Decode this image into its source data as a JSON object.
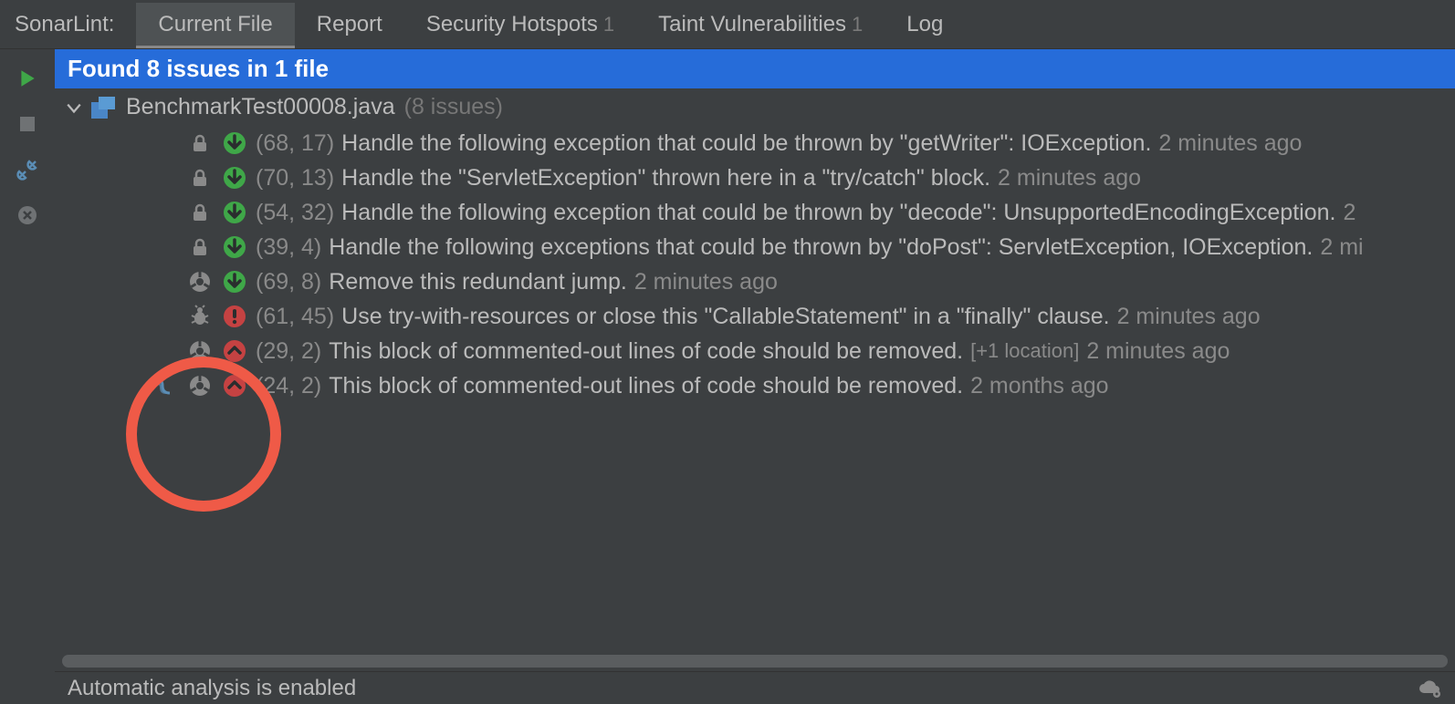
{
  "tool_name": "SonarLint:",
  "tabs": [
    {
      "label": "Current File",
      "active": true
    },
    {
      "label": "Report",
      "active": false
    },
    {
      "label": "Security Hotspots",
      "count": "1",
      "active": false
    },
    {
      "label": "Taint Vulnerabilities",
      "count": "1",
      "active": false
    },
    {
      "label": "Log",
      "active": false
    }
  ],
  "header": "Found 8 issues in 1 file",
  "file": {
    "name": "BenchmarkTest00008.java",
    "issues_label": "(8 issues)"
  },
  "issues": [
    {
      "type": "lock",
      "sev": "down-green",
      "loc": "(68, 17)",
      "msg": "Handle the following exception that could be thrown by \"getWriter\": IOException.",
      "time": "2 minutes ago"
    },
    {
      "type": "lock",
      "sev": "down-green",
      "loc": "(70, 13)",
      "msg": "Handle the \"ServletException\" thrown here in a \"try/catch\" block.",
      "time": "2 minutes ago"
    },
    {
      "type": "lock",
      "sev": "down-green",
      "loc": "(54, 32)",
      "msg": "Handle the following exception that could be thrown by \"decode\": UnsupportedEncodingException.",
      "time": "2"
    },
    {
      "type": "lock",
      "sev": "down-green",
      "loc": "(39, 4)",
      "msg": "Handle the following exceptions that could be thrown by \"doPost\": ServletException, IOException.",
      "time": "2 mi"
    },
    {
      "type": "smell",
      "sev": "down-green",
      "loc": "(69, 8)",
      "msg": "Remove this redundant jump.",
      "time": "2 minutes ago"
    },
    {
      "type": "bug",
      "sev": "excl-red",
      "loc": "(61, 45)",
      "msg": "Use try-with-resources or close this \"CallableStatement\" in a \"finally\" clause.",
      "time": "2 minutes ago"
    },
    {
      "type": "smell",
      "sev": "chev-red",
      "loc": "(29, 2)",
      "msg": "This block of commented-out lines of code should be removed.",
      "extra": "[+1 location]",
      "time": "2 minutes ago"
    },
    {
      "type": "smell",
      "sev": "chev-red",
      "loc": "(24, 2)",
      "msg": "This block of commented-out lines of code should be removed.",
      "time": "2 months ago",
      "connected": true
    }
  ],
  "status_text": "Automatic analysis is enabled"
}
